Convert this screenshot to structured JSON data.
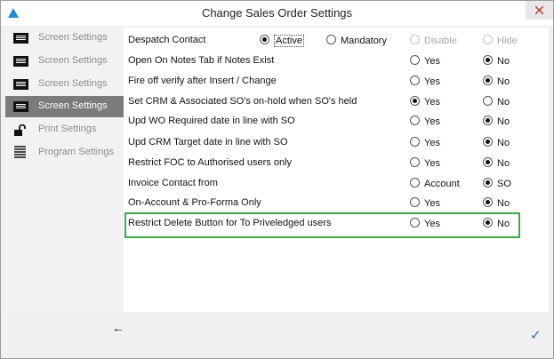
{
  "window": {
    "title": "Change Sales Order Settings"
  },
  "sidebar": {
    "items": [
      {
        "label": "Screen Settings",
        "icon": "keyboard-icon",
        "active": false
      },
      {
        "label": "Screen Settings",
        "icon": "keyboard-icon",
        "active": false
      },
      {
        "label": "Screen Settings",
        "icon": "keyboard-icon",
        "active": false
      },
      {
        "label": "Screen Settings",
        "icon": "keyboard-icon",
        "active": true
      },
      {
        "label": "Print Settings",
        "icon": "unlock-icon",
        "active": false
      },
      {
        "label": "Program Settings",
        "icon": "document-lines-icon",
        "active": false
      }
    ],
    "back_glyph": "🠐"
  },
  "settings": {
    "rows": [
      {
        "label": "Despatch Contact",
        "options": [
          {
            "text": "Active",
            "selected": true,
            "enabled": true
          },
          {
            "text": "Mandatory",
            "selected": false,
            "enabled": true
          },
          {
            "text": "Disable",
            "selected": false,
            "enabled": false
          },
          {
            "text": "Hide",
            "selected": false,
            "enabled": false
          }
        ]
      },
      {
        "label": "Open On Notes Tab if Notes Exist",
        "options": [
          {
            "text": "Yes",
            "selected": false
          },
          {
            "text": "No",
            "selected": true
          }
        ]
      },
      {
        "label": "Fire off verify after Insert / Change",
        "options": [
          {
            "text": "Yes",
            "selected": false
          },
          {
            "text": "No",
            "selected": true
          }
        ]
      },
      {
        "label": "Set CRM & Associated SO's on-hold when SO's held",
        "options": [
          {
            "text": "Yes",
            "selected": true
          },
          {
            "text": "No",
            "selected": false
          }
        ]
      },
      {
        "label": "Upd WO Required date in line with SO",
        "options": [
          {
            "text": "Yes",
            "selected": false
          },
          {
            "text": "No",
            "selected": true
          }
        ]
      },
      {
        "label": "Upd CRM Target date in line with SO",
        "options": [
          {
            "text": "Yes",
            "selected": false
          },
          {
            "text": "No",
            "selected": true
          }
        ]
      },
      {
        "label": "Restrict FOC to Authorised users only",
        "options": [
          {
            "text": "Yes",
            "selected": false
          },
          {
            "text": "No",
            "selected": true
          }
        ]
      },
      {
        "label": "Invoice Contact from",
        "options": [
          {
            "text": "Account",
            "selected": false
          },
          {
            "text": "SO",
            "selected": true
          }
        ]
      },
      {
        "label": "On-Account & Pro-Forma Only",
        "options": [
          {
            "text": "Yes",
            "selected": false
          },
          {
            "text": "No",
            "selected": true
          }
        ]
      },
      {
        "label": "Restrict Delete Button for To Priveledged users",
        "options": [
          {
            "text": "Yes",
            "selected": false
          },
          {
            "text": "No",
            "selected": true
          }
        ]
      }
    ]
  },
  "footer": {
    "ok_glyph": "✓"
  },
  "colors": {
    "highlight": "#3ea843",
    "sidebar_active": "#7b7b7b",
    "ok": "#2a6ebf"
  }
}
